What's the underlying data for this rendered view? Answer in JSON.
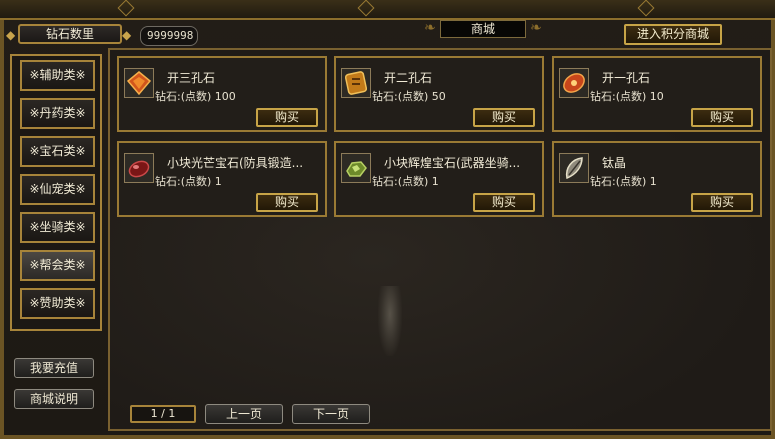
{
  "header": {
    "gem_label": "钻石数里",
    "gem_value": "9999998",
    "title": "商城",
    "points_mall_button": "进入积分商城"
  },
  "sidebar": {
    "categories": [
      {
        "label": "※辅助类※",
        "active": false
      },
      {
        "label": "※丹药类※",
        "active": false
      },
      {
        "label": "※宝石类※",
        "active": false
      },
      {
        "label": "※仙宠类※",
        "active": false
      },
      {
        "label": "※坐骑类※",
        "active": false
      },
      {
        "label": "※帮会类※",
        "active": true
      },
      {
        "label": "※赞助类※",
        "active": false
      }
    ],
    "recharge_button": "我要充值",
    "help_button": "商城说明"
  },
  "items": [
    {
      "name": "开三孔石",
      "price": "钻石:(点数) 100",
      "buy": "购买",
      "icon": "three-slot-stone-icon"
    },
    {
      "name": "开二孔石",
      "price": "钻石:(点数) 50",
      "buy": "购买",
      "icon": "two-slot-stone-icon"
    },
    {
      "name": "开一孔石",
      "price": "钻石:(点数) 10",
      "buy": "购买",
      "icon": "one-slot-stone-icon"
    },
    {
      "name": "小块光芒宝石(防具锻造...",
      "price": "钻石:(点数) 1",
      "buy": "购买",
      "icon": "radiant-gem-icon"
    },
    {
      "name": "小块辉煌宝石(武器坐骑...",
      "price": "钻石:(点数) 1",
      "buy": "购买",
      "icon": "brilliant-gem-icon"
    },
    {
      "name": "钛晶",
      "price": "钻石:(点数) 1",
      "buy": "购买",
      "icon": "titanium-crystal-icon"
    }
  ],
  "pager": {
    "page": "1 / 1",
    "prev": "上一页",
    "next": "下一页"
  },
  "colors": {
    "frame_gold": "#a7843a",
    "background": "#1f1b17",
    "text": "#efe9d4"
  }
}
